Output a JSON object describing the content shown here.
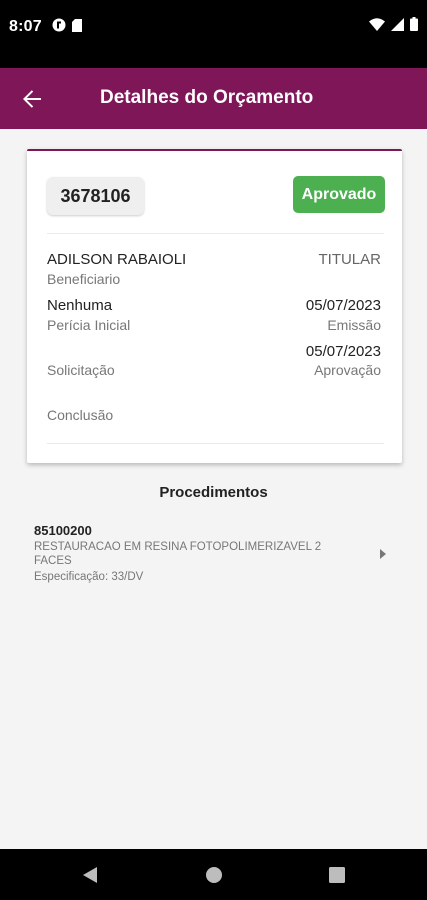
{
  "status_bar": {
    "time": "8:07"
  },
  "app_bar": {
    "title": "Detalhes do Orçamento"
  },
  "card": {
    "code": "3678106",
    "status": "Aprovado",
    "beneficiary_name": "ADILSON RABAIOLI",
    "beneficiary_type": "TITULAR",
    "beneficiary_label": "Beneficiario",
    "pericia_value": "Nenhuma",
    "pericia_label": "Perícia Inicial",
    "emissao_date": "05/07/2023",
    "emissao_label": "Emissão",
    "aprovacao_date": "05/07/2023",
    "solicitacao_label": "Solicitação",
    "aprovacao_label": "Aprovação",
    "conclusao_label": "Conclusão"
  },
  "procedimentos": {
    "title": "Procedimentos",
    "items": [
      {
        "code": "85100200",
        "description": "RESTAURACAO EM RESINA FOTOPOLIMERIZAVEL  2 FACES",
        "spec": "Especificação: 33/DV"
      }
    ]
  },
  "colors": {
    "primary": "#7e1657",
    "status_green": "#4caf50"
  },
  "icons": {
    "back": "arrow-left-icon",
    "chevron": "chevron-right-icon"
  }
}
